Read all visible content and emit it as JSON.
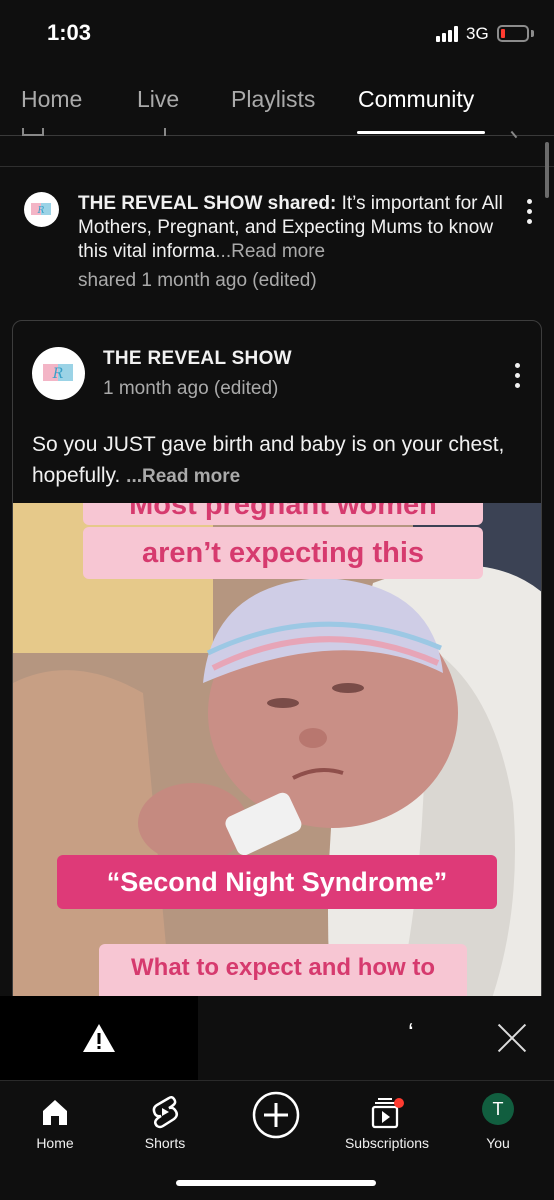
{
  "status_bar": {
    "time": "1:03",
    "network": "3G",
    "battery_color": "#ff3b30"
  },
  "tabs": [
    {
      "label": "Home",
      "active": false
    },
    {
      "label": "Live",
      "active": false
    },
    {
      "label": "Playlists",
      "active": false
    },
    {
      "label": "Community",
      "active": true
    }
  ],
  "shared_post": {
    "author_prefix": "THE REVEAL SHOW shared:",
    "text": " It’s important for All Mothers, Pregnant, and Expecting Mums to know this vital informa",
    "read_more": "...Read more",
    "meta": "shared 1 month ago (edited)"
  },
  "post": {
    "author": "THE REVEAL SHOW",
    "time": "1 month ago (edited)",
    "text": "So you JUST gave birth and baby is on your chest, hopefully. ",
    "read_more": "...Read more",
    "image_captions": {
      "top_partial": "Most pregnant women",
      "top": "aren’t expecting this",
      "middle": "“Second Night Syndrome”",
      "bottom": "What to expect and how to"
    },
    "caption_color": "#d63a6e",
    "caption_bg": "#f7c6d3"
  },
  "ad_bar": {
    "mark": "ʻ"
  },
  "bottom_nav": [
    {
      "label": "Home",
      "icon": "home-icon"
    },
    {
      "label": "Shorts",
      "icon": "shorts-icon"
    },
    {
      "label": "",
      "icon": "create-icon"
    },
    {
      "label": "Subscriptions",
      "icon": "subscriptions-icon"
    },
    {
      "label": "You",
      "icon": "avatar",
      "initial": "T"
    }
  ]
}
